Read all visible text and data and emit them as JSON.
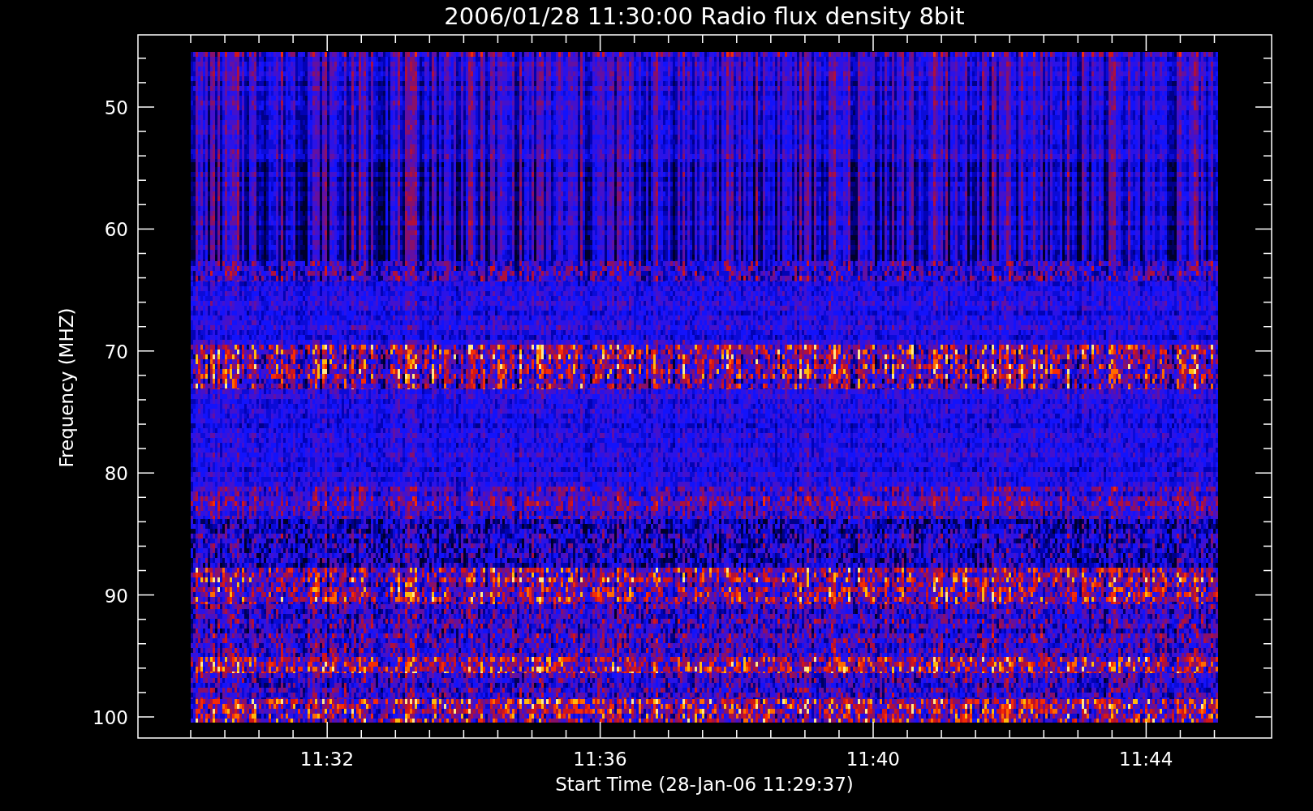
{
  "title": "2006/01/28 11:30:00 Radio flux density 8bit",
  "y_axis": {
    "label": "Frequency (MHZ)",
    "ticks": [
      "50",
      "60",
      "70",
      "80",
      "90",
      "100"
    ]
  },
  "x_axis": {
    "label": "Start Time (28-Jan-06 11:29:37)",
    "ticks": [
      "11:32",
      "11:36",
      "11:40",
      "11:44"
    ]
  }
}
